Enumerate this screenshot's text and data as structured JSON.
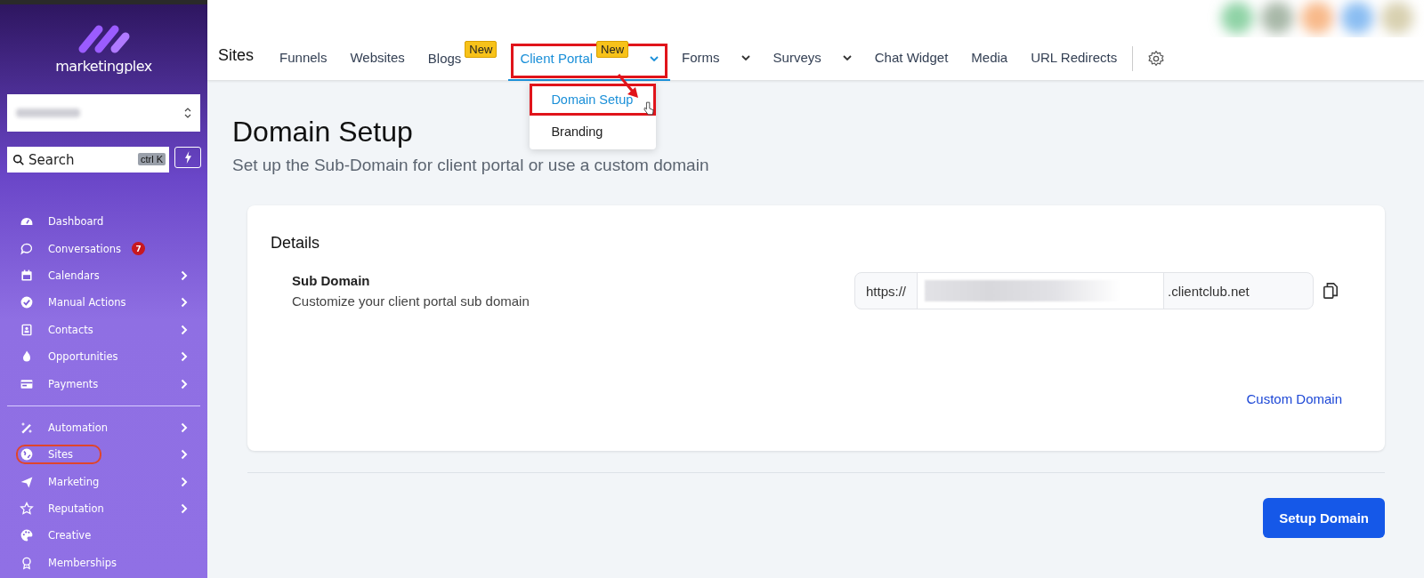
{
  "sidebar": {
    "brand": "marketingplex",
    "search": {
      "placeholder": "Search",
      "shortcut": "ctrl K"
    },
    "items": [
      {
        "label": "Dashboard",
        "submenu": false,
        "highlighted": false
      },
      {
        "label": "Conversations",
        "badge": "7",
        "submenu": false,
        "highlighted": false
      },
      {
        "label": "Calendars",
        "submenu": true,
        "highlighted": false
      },
      {
        "label": "Manual Actions",
        "submenu": true,
        "highlighted": false
      },
      {
        "label": "Contacts",
        "submenu": true,
        "highlighted": false
      },
      {
        "label": "Opportunities",
        "submenu": true,
        "highlighted": false
      },
      {
        "label": "Payments",
        "submenu": true,
        "highlighted": false
      },
      {
        "label": "Automation",
        "submenu": true,
        "highlighted": false
      },
      {
        "label": "Sites",
        "submenu": true,
        "highlighted": true
      },
      {
        "label": "Marketing",
        "submenu": true,
        "highlighted": false
      },
      {
        "label": "Reputation",
        "submenu": true,
        "highlighted": false
      },
      {
        "label": "Creative",
        "submenu": false,
        "highlighted": false
      },
      {
        "label": "Memberships",
        "submenu": false,
        "highlighted": false
      }
    ]
  },
  "nav": {
    "title": "Sites",
    "tabs": [
      {
        "label": "Funnels",
        "selected": false,
        "dropdown": false,
        "highlighted": false
      },
      {
        "label": "Websites",
        "selected": false,
        "dropdown": false,
        "highlighted": false
      },
      {
        "label": "Blogs",
        "selected": false,
        "badge": "New",
        "dropdown": false,
        "highlighted": false
      },
      {
        "label": "Client Portal",
        "selected": true,
        "badge": "New",
        "dropdown": true,
        "highlighted": true,
        "menu": [
          {
            "label": "Domain Setup",
            "selected": true,
            "highlighted": true
          },
          {
            "label": "Branding",
            "selected": false,
            "highlighted": false
          }
        ]
      },
      {
        "label": "Forms",
        "selected": false,
        "dropdown": true,
        "highlighted": false
      },
      {
        "label": "Surveys",
        "selected": false,
        "dropdown": true,
        "highlighted": false
      },
      {
        "label": "Chat Widget",
        "selected": false,
        "dropdown": false,
        "highlighted": false
      },
      {
        "label": "Media",
        "selected": false,
        "dropdown": false,
        "highlighted": false
      },
      {
        "label": "URL Redirects",
        "selected": false,
        "dropdown": false,
        "highlighted": false
      }
    ]
  },
  "page": {
    "title": "Domain Setup",
    "subtitle": "Set up the Sub-Domain for client portal or use a custom domain"
  },
  "card": {
    "title": "Details",
    "field": {
      "label": "Sub Domain",
      "description": "Customize your client portal sub domain",
      "prefix": "https://",
      "suffix": ".clientclub.net"
    },
    "link": "Custom Domain"
  },
  "button": "Setup Domain"
}
